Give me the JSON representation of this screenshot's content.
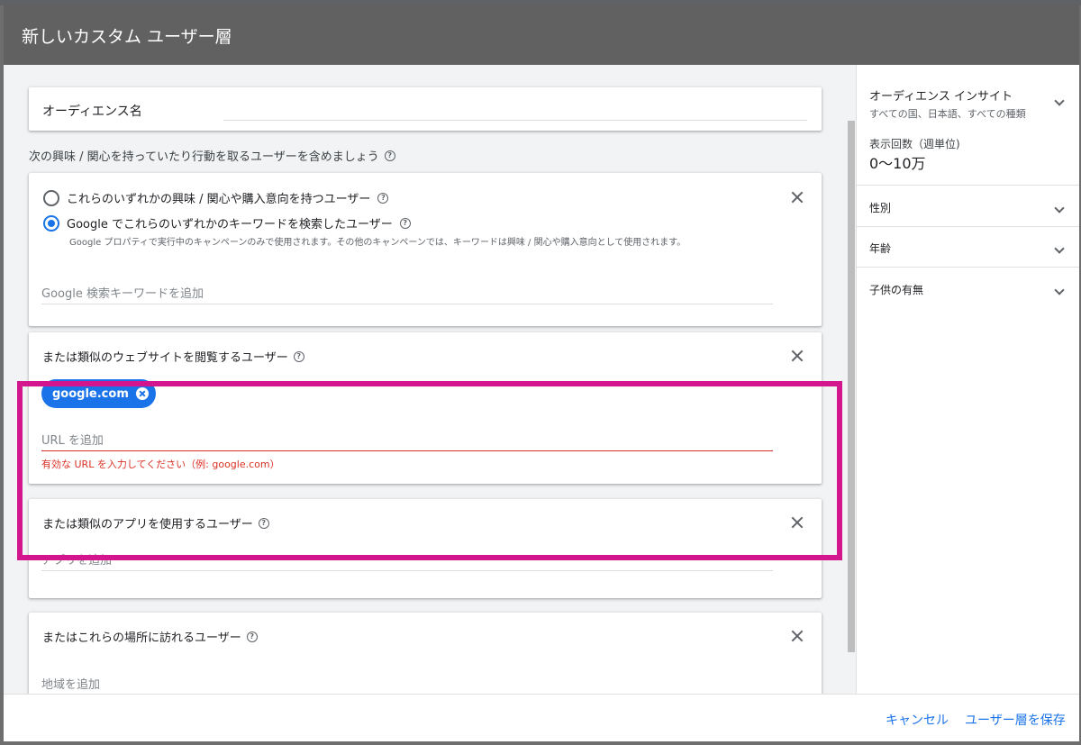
{
  "dialog": {
    "title": "新しいカスタム ユーザー層"
  },
  "main": {
    "name_label": "オーディエンス名",
    "section_heading": "次の興味 / 関心を持っていたり行動を取るユーザーを含めましょう",
    "interests": {
      "radio_1": "これらのいずれかの興味 / 関心や購入意向を持つユーザー",
      "radio_2": "Google でこれらのいずれかのキーワードを検索したユーザー",
      "radio_2_note": "Google プロパティで実行中のキャンペーンのみで使用されます。その他のキャンペーンでは、キーワードは興味 / 関心や購入意向として使用されます。",
      "placeholder": "Google 検索キーワードを追加"
    },
    "websites": {
      "title": "または類似のウェブサイトを閲覧するユーザー",
      "chip": "google.com",
      "placeholder": "URL を追加",
      "error": "有効な URL を入力してください（例: google.com）"
    },
    "apps": {
      "title": "または類似のアプリを使用するユーザー",
      "placeholder": "アプリを追加"
    },
    "places": {
      "title": "またはこれらの場所に訪れるユーザー",
      "placeholder": "地域を追加"
    }
  },
  "sidebar": {
    "insight_title": "オーディエンス インサイト",
    "insight_sub": "すべての国、日本語、すべての種類",
    "impressions_label": "表示回数（週単位)",
    "impressions_value": "0〜10万",
    "accordions": [
      "性別",
      "年齢",
      "子供の有無"
    ]
  },
  "footer": {
    "cancel": "キャンセル",
    "save": "ユーザー層を保存"
  },
  "colors": {
    "accent": "#1a73e8",
    "error": "#d93025",
    "highlight": "#d4168e",
    "header": "#616161"
  }
}
